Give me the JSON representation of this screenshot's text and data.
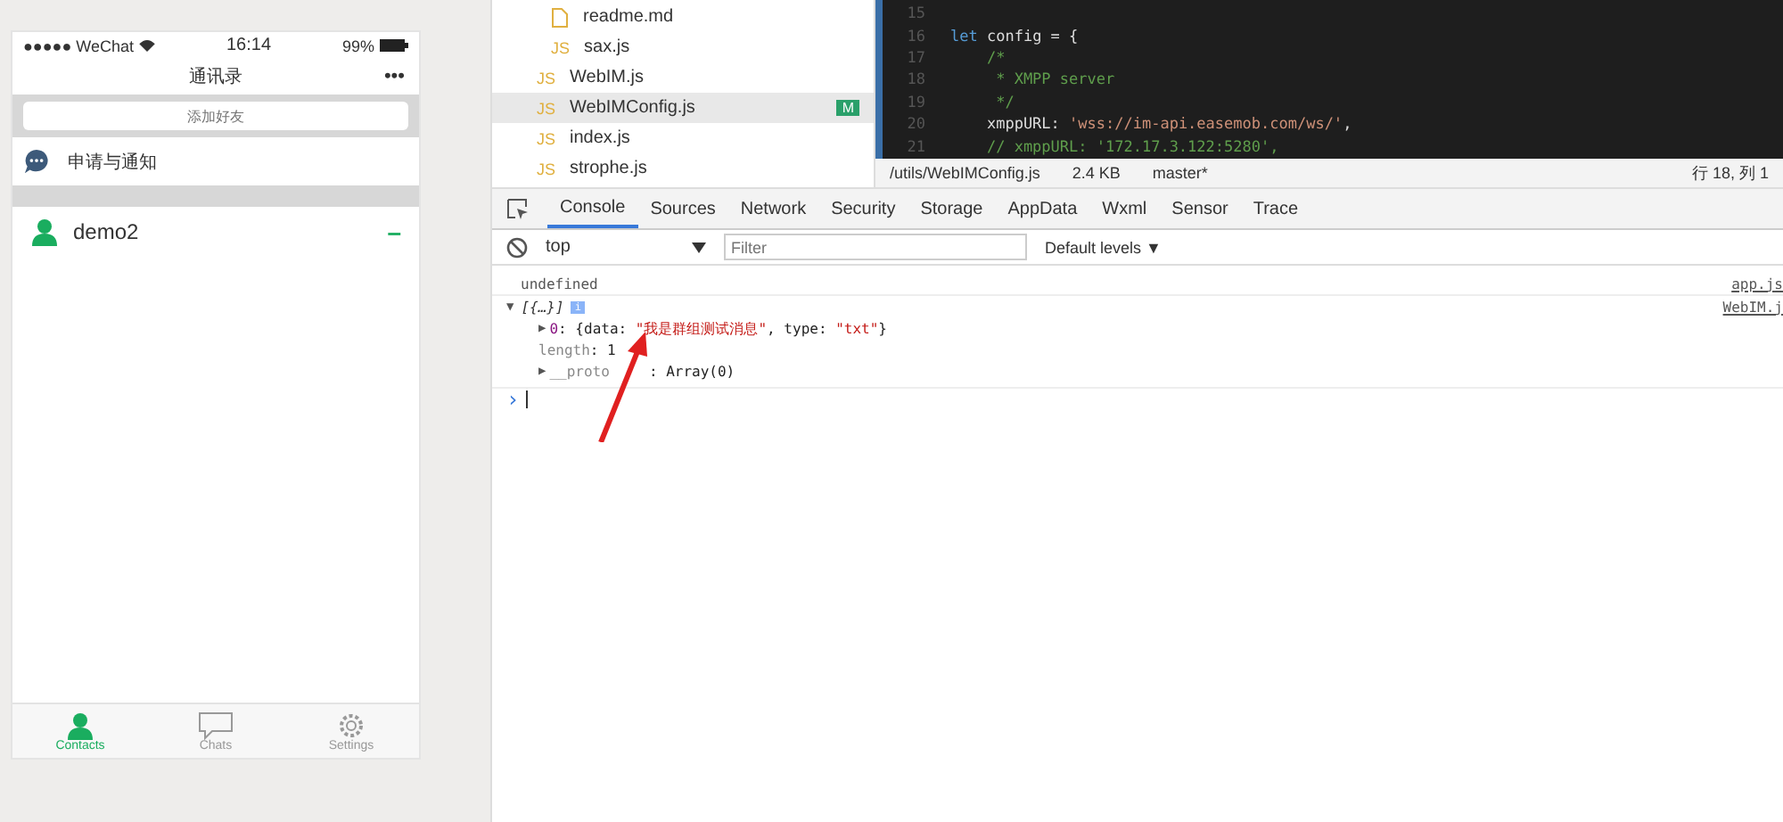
{
  "phone": {
    "status_bar": {
      "carrier": "●●●●● WeChat",
      "time": "16:14",
      "battery": "99%"
    },
    "nav": {
      "title": "通讯录",
      "menu": "•••"
    },
    "search": {
      "placeholder": "添加好友"
    },
    "notice": {
      "label": "申请与通知"
    },
    "contacts": [
      {
        "name": "demo2",
        "action": "–"
      }
    ],
    "tabs": [
      {
        "label": "Contacts",
        "kind": "person",
        "selected": true
      },
      {
        "label": "Chats",
        "kind": "chat",
        "selected": false
      },
      {
        "label": "Settings",
        "kind": "gear",
        "selected": false
      }
    ]
  },
  "files": [
    {
      "children": [
        {
          "name": "readme.md",
          "kind": "md"
        },
        {
          "name": "sax.js",
          "kind": "js",
          "icon": "JS"
        }
      ]
    },
    {
      "name": "WebIM.js",
      "kind": "js",
      "icon": "JS",
      "selected": false
    },
    {
      "name": "WebIMConfig.js",
      "kind": "js",
      "icon": "JS",
      "selected": true,
      "badge": "M"
    },
    {
      "name": "index.js",
      "kind": "js",
      "icon": "JS",
      "selected": false
    },
    {
      "name": "strophe.js",
      "kind": "js",
      "icon": "JS",
      "selected": false
    }
  ],
  "editor": {
    "lines": [
      {
        "number": "15"
      },
      {
        "number": "16",
        "segments": [
          {
            "kind": "keyword",
            "text": "let"
          },
          {
            "kind": "plain",
            "text": " config = {"
          }
        ]
      },
      {
        "number": "17",
        "segments": [
          {
            "kind": "comment",
            "text": "    /*"
          }
        ]
      },
      {
        "number": "18",
        "segments": [
          {
            "kind": "comment",
            "text": "     * XMPP server"
          }
        ]
      },
      {
        "number": "19",
        "segments": [
          {
            "kind": "comment",
            "text": "     */"
          }
        ]
      },
      {
        "number": "20",
        "segments": [
          {
            "kind": "plain",
            "text": "    xmppURL: "
          },
          {
            "kind": "string",
            "text": "'wss://im-api.easemob.com/ws/'"
          },
          {
            "kind": "plain",
            "text": ","
          }
        ]
      },
      {
        "number": "21",
        "segments": [
          {
            "kind": "comment",
            "text": "    // xmppURL: '172.17.3.122:5280',"
          }
        ]
      }
    ]
  },
  "status_bar": {
    "path": "/utils/WebIMConfig.js",
    "size": "2.4 KB",
    "branch": "master*",
    "position": "行 18, 列 1"
  },
  "devtools": {
    "tabs": [
      {
        "label": "Console",
        "selected": true
      },
      {
        "label": "Sources",
        "selected": false
      },
      {
        "label": "Network",
        "selected": false
      },
      {
        "label": "Security",
        "selected": false
      },
      {
        "label": "Storage",
        "selected": false
      },
      {
        "label": "AppData",
        "selected": false
      },
      {
        "label": "Wxml",
        "selected": false
      },
      {
        "label": "Sensor",
        "selected": false
      },
      {
        "label": "Trace",
        "selected": false
      }
    ],
    "context": "top",
    "filter_placeholder": "Filter",
    "levels": "Default levels ▼",
    "console": [
      {
        "kind": "plain",
        "text": "undefined",
        "source": "app.js"
      },
      {
        "kind": "object",
        "toggle": "▼",
        "text": "[{…}]",
        "source": "WebIM.j",
        "badge": "i",
        "children": [
          {
            "kind": "prop",
            "toggle": "▶",
            "key": "0",
            "value": ": {data: ",
            "str": "\"我是群组测试消息\"",
            "rest": ", type: ",
            "str2": "\"txt\"",
            "end": "}"
          },
          {
            "kind": "len",
            "key": "length",
            "value": ": 1"
          },
          {
            "kind": "proto",
            "toggle": "▶",
            "key": "__proto",
            "value": ": Array(0)"
          }
        ]
      }
    ],
    "prompt": "›"
  }
}
